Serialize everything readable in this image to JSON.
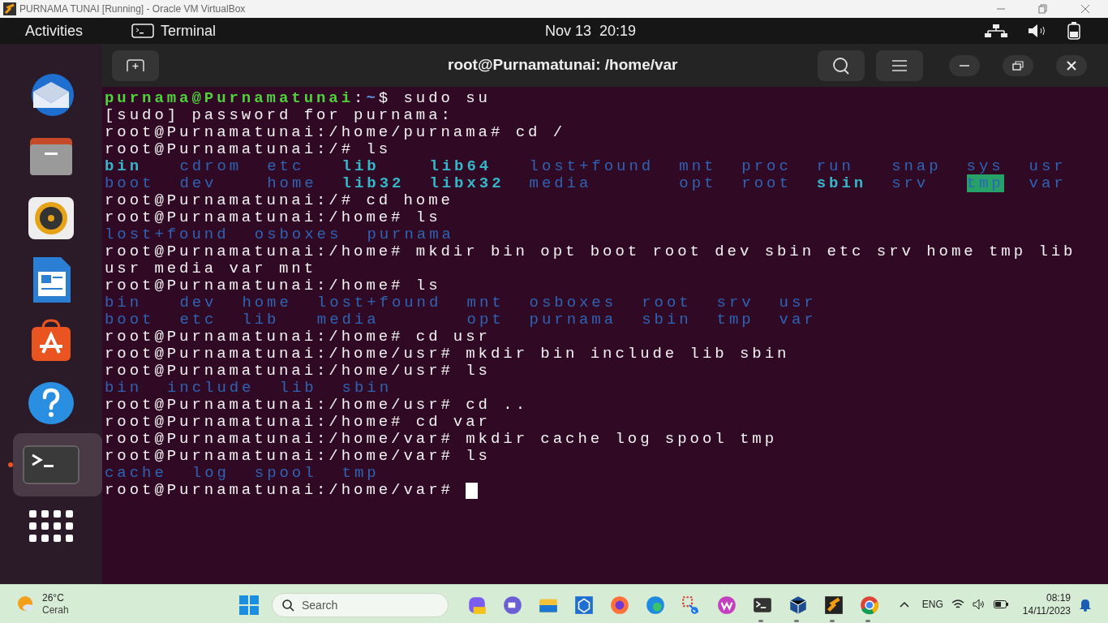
{
  "host_window": {
    "title": "PURNAMA TUNAI [Running] - Oracle VM VirtualBox"
  },
  "top_bar": {
    "activities": "Activities",
    "app": "Terminal",
    "clock": "Nov 13  20:19"
  },
  "dock": {
    "items": [
      {
        "kind": "mail",
        "running": false
      },
      {
        "kind": "files",
        "running": false
      },
      {
        "kind": "music",
        "running": false
      },
      {
        "kind": "writer",
        "running": false
      },
      {
        "kind": "store",
        "running": false
      },
      {
        "kind": "help",
        "running": false
      },
      {
        "kind": "terminal",
        "running": true
      },
      {
        "kind": "apps",
        "running": false
      }
    ]
  },
  "terminal": {
    "title": "root@Purnamatunai: /home/var",
    "lines": [
      {
        "kind": "user-prompt",
        "user": "purnama@Purnamatunai",
        "separator": ":",
        "path": "~",
        "sign": "$ ",
        "command": "sudo su"
      },
      {
        "kind": "output",
        "text": "[sudo] password for purnama:"
      },
      {
        "kind": "prompt",
        "prompt": "root@Purnamatunai:/home/purnama# ",
        "command": "cd /"
      },
      {
        "kind": "prompt",
        "prompt": "root@Purnamatunai:/# ",
        "command": "ls"
      },
      {
        "kind": "listing",
        "rows": [
          [
            {
              "name": "bin",
              "kind": "link"
            },
            {
              "name": "cdrom",
              "kind": "dir"
            },
            {
              "name": "etc",
              "kind": "dir"
            },
            {
              "name": "lib",
              "kind": "link"
            },
            {
              "name": "lib64",
              "kind": "link"
            },
            {
              "name": "lost+found",
              "kind": "dir"
            },
            {
              "name": "mnt",
              "kind": "dir"
            },
            {
              "name": "proc",
              "kind": "dir"
            },
            {
              "name": "run",
              "kind": "dir"
            },
            {
              "name": "snap",
              "kind": "dir"
            },
            {
              "name": "sys",
              "kind": "dir"
            },
            {
              "name": "usr",
              "kind": "dir"
            }
          ],
          [
            {
              "name": "boot",
              "kind": "dir"
            },
            {
              "name": "dev",
              "kind": "dir"
            },
            {
              "name": "home",
              "kind": "dir"
            },
            {
              "name": "lib32",
              "kind": "link"
            },
            {
              "name": "libx32",
              "kind": "link"
            },
            {
              "name": "media",
              "kind": "dir"
            },
            {
              "name": "opt",
              "kind": "dir"
            },
            {
              "name": "root",
              "kind": "dir"
            },
            {
              "name": "sbin",
              "kind": "link"
            },
            {
              "name": "srv",
              "kind": "dir"
            },
            {
              "name": "tmp",
              "kind": "sticky"
            },
            {
              "name": "var",
              "kind": "dir"
            }
          ]
        ]
      },
      {
        "kind": "prompt",
        "prompt": "root@Purnamatunai:/# ",
        "command": "cd home"
      },
      {
        "kind": "prompt",
        "prompt": "root@Purnamatunai:/home# ",
        "command": "ls"
      },
      {
        "kind": "listing",
        "rows": [
          [
            {
              "name": "lost+found",
              "kind": "dir"
            },
            {
              "name": "osboxes",
              "kind": "dir"
            },
            {
              "name": "purnama",
              "kind": "dir"
            }
          ]
        ]
      },
      {
        "kind": "prompt",
        "prompt": "root@Purnamatunai:/home# ",
        "command": "mkdir bin opt boot root dev sbin etc srv home tmp lib"
      },
      {
        "kind": "output",
        "text": "usr media var mnt"
      },
      {
        "kind": "prompt",
        "prompt": "root@Purnamatunai:/home# ",
        "command": "ls"
      },
      {
        "kind": "listing",
        "rows": [
          [
            {
              "name": "bin",
              "kind": "dir"
            },
            {
              "name": "dev",
              "kind": "dir"
            },
            {
              "name": "home",
              "kind": "dir"
            },
            {
              "name": "lost+found",
              "kind": "dir"
            },
            {
              "name": "mnt",
              "kind": "dir"
            },
            {
              "name": "osboxes",
              "kind": "dir"
            },
            {
              "name": "root",
              "kind": "dir"
            },
            {
              "name": "srv",
              "kind": "dir"
            },
            {
              "name": "usr",
              "kind": "dir"
            }
          ],
          [
            {
              "name": "boot",
              "kind": "dir"
            },
            {
              "name": "etc",
              "kind": "dir"
            },
            {
              "name": "lib",
              "kind": "dir"
            },
            {
              "name": "media",
              "kind": "dir"
            },
            {
              "name": "opt",
              "kind": "dir"
            },
            {
              "name": "purnama",
              "kind": "dir"
            },
            {
              "name": "sbin",
              "kind": "dir"
            },
            {
              "name": "tmp",
              "kind": "dir"
            },
            {
              "name": "var",
              "kind": "dir"
            }
          ]
        ]
      },
      {
        "kind": "prompt",
        "prompt": "root@Purnamatunai:/home# ",
        "command": "cd usr"
      },
      {
        "kind": "prompt",
        "prompt": "root@Purnamatunai:/home/usr# ",
        "command": "mkdir bin include lib sbin"
      },
      {
        "kind": "prompt",
        "prompt": "root@Purnamatunai:/home/usr# ",
        "command": "ls"
      },
      {
        "kind": "listing",
        "rows": [
          [
            {
              "name": "bin",
              "kind": "dir"
            },
            {
              "name": "include",
              "kind": "dir"
            },
            {
              "name": "lib",
              "kind": "dir"
            },
            {
              "name": "sbin",
              "kind": "dir"
            }
          ]
        ]
      },
      {
        "kind": "prompt",
        "prompt": "root@Purnamatunai:/home/usr# ",
        "command": "cd .."
      },
      {
        "kind": "prompt",
        "prompt": "root@Purnamatunai:/home# ",
        "command": "cd var"
      },
      {
        "kind": "prompt",
        "prompt": "root@Purnamatunai:/home/var# ",
        "command": "mkdir cache log spool tmp"
      },
      {
        "kind": "prompt",
        "prompt": "root@Purnamatunai:/home/var# ",
        "command": "ls"
      },
      {
        "kind": "listing",
        "rows": [
          [
            {
              "name": "cache",
              "kind": "dir"
            },
            {
              "name": "log",
              "kind": "dir"
            },
            {
              "name": "spool",
              "kind": "dir"
            },
            {
              "name": "tmp",
              "kind": "dir"
            }
          ]
        ]
      },
      {
        "kind": "prompt",
        "prompt": "root@Purnamatunai:/home/var# ",
        "cursor": true
      }
    ]
  },
  "taskbar": {
    "weather": {
      "temperature": "26°C",
      "condition": "Cerah"
    },
    "search": {
      "placeholder": "Search"
    },
    "apps": [
      {
        "kind": "copilot",
        "running": false
      },
      {
        "kind": "meet",
        "running": false
      },
      {
        "kind": "explorer",
        "running": false
      },
      {
        "kind": "cube",
        "running": false
      },
      {
        "kind": "firefox",
        "running": false
      },
      {
        "kind": "edge",
        "running": false
      },
      {
        "kind": "snip",
        "running": false
      },
      {
        "kind": "wps",
        "running": false
      },
      {
        "kind": "terminal",
        "running": true
      },
      {
        "kind": "virtualbox",
        "running": true
      },
      {
        "kind": "vm",
        "running": true
      },
      {
        "kind": "chrome",
        "running": true
      }
    ],
    "language": "ENG",
    "time": "08:19",
    "date": "14/11/2023"
  }
}
